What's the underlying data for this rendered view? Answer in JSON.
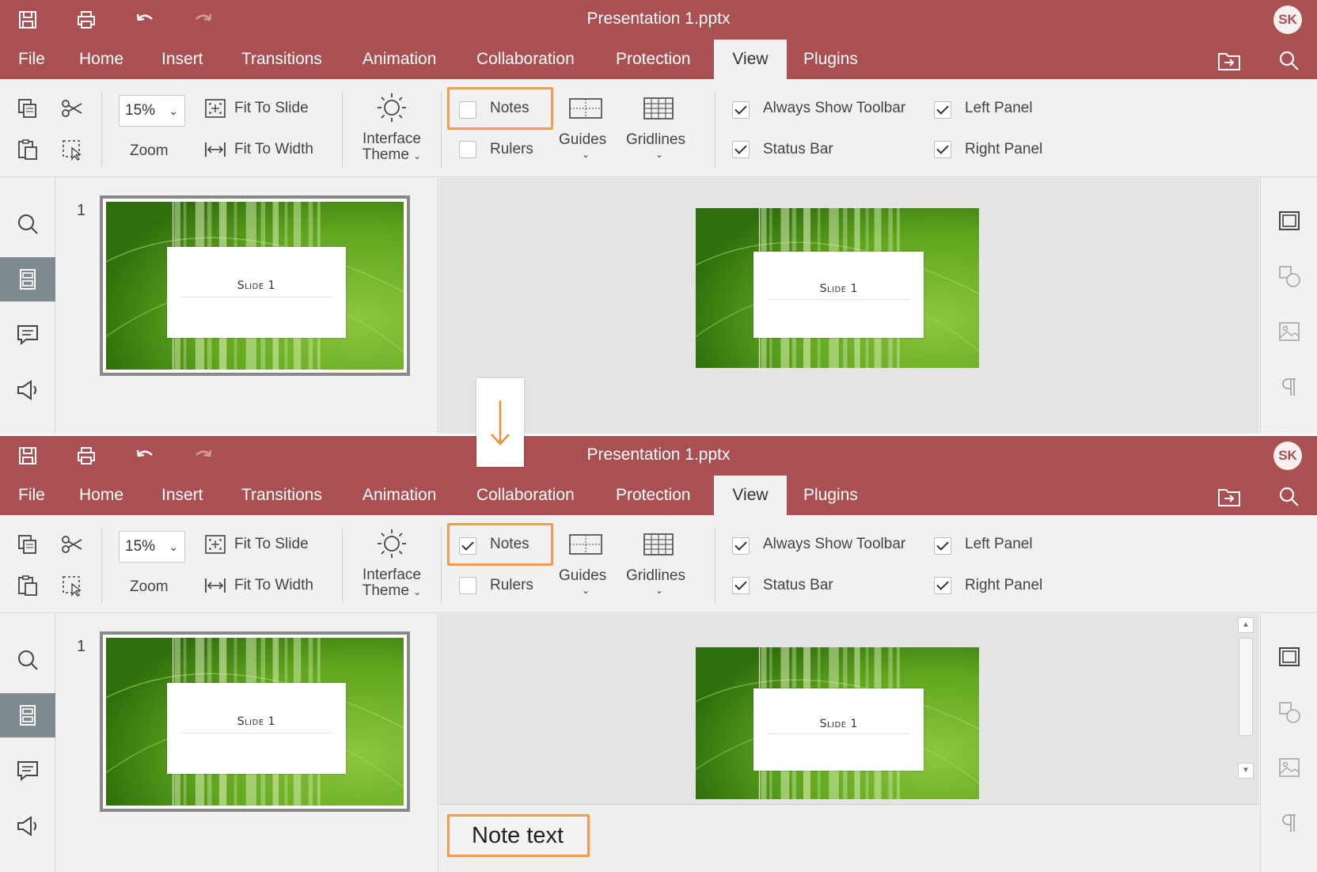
{
  "window": {
    "title": "Presentation 1.pptx",
    "user_initials": "SK"
  },
  "menu": {
    "items": [
      "File",
      "Home",
      "Insert",
      "Transitions",
      "Animation",
      "Collaboration",
      "Protection",
      "View",
      "Plugins"
    ],
    "active": "View"
  },
  "toolbar": {
    "zoom_value": "15%",
    "zoom_label": "Zoom",
    "fit_to_slide": "Fit To Slide",
    "fit_to_width": "Fit To Width",
    "interface_theme_line1": "Interface",
    "interface_theme_line2": "Theme",
    "notes_label": "Notes",
    "rulers_label": "Rulers",
    "guides_label": "Guides",
    "gridlines_label": "Gridlines",
    "always_show_toolbar": "Always Show Toolbar",
    "status_bar": "Status Bar",
    "left_panel": "Left Panel",
    "right_panel": "Right Panel"
  },
  "states": {
    "before": {
      "notes_checked": false,
      "rulers_checked": false,
      "always_show_toolbar_checked": true,
      "status_bar_checked": true,
      "left_panel_checked": true,
      "right_panel_checked": true
    },
    "after": {
      "notes_checked": true,
      "rulers_checked": false,
      "always_show_toolbar_checked": true,
      "status_bar_checked": true,
      "left_panel_checked": true,
      "right_panel_checked": true
    }
  },
  "slides": {
    "thumbnail_number": "1",
    "slide_title": "Slide 1"
  },
  "notes": {
    "text": "Note text"
  },
  "colors": {
    "titlebar": "#aa4f52",
    "highlight": "#f39c4a",
    "slide_green": "#5a9e1a"
  }
}
